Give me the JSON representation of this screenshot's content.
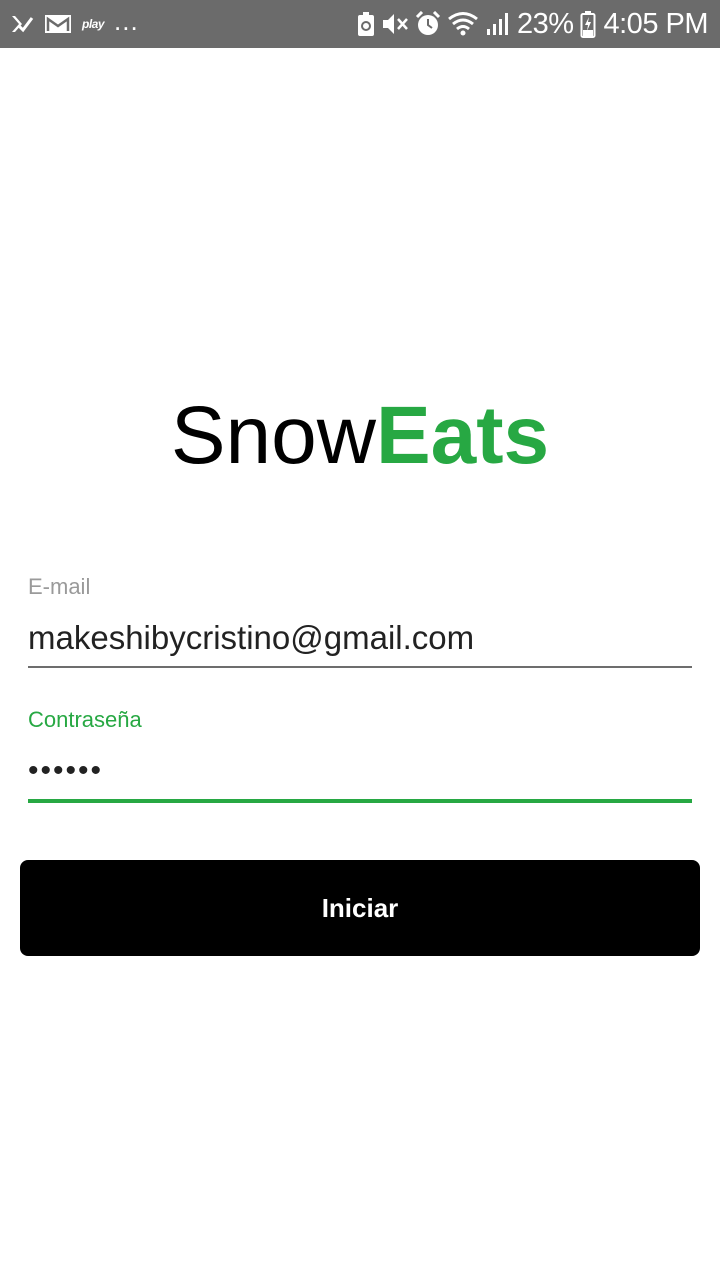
{
  "status_bar": {
    "left_icons": [
      "check-notification-icon",
      "gmail-icon",
      "play-music-icon"
    ],
    "play_label": "play",
    "more_indicator": "...",
    "right_icons": [
      "battery-saver-icon",
      "mute-icon",
      "alarm-icon",
      "wifi-icon",
      "signal-icon",
      "battery-icon"
    ],
    "battery_percent": "23%",
    "time": "4:05 PM"
  },
  "logo": {
    "part1": "Snow",
    "part2": "Eats",
    "accent_color": "#27a843"
  },
  "form": {
    "email": {
      "label": "E-mail",
      "value": "makeshibycristino@gmail.com"
    },
    "password": {
      "label": "Contraseña",
      "value": "••••••"
    }
  },
  "submit": {
    "label": "Iniciar"
  }
}
